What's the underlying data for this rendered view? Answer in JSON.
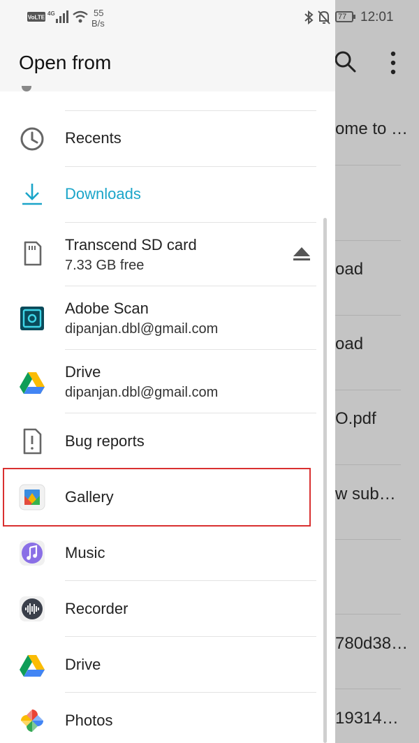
{
  "status_bar": {
    "speed_value": "55",
    "speed_unit": "B/s",
    "battery": "77",
    "time": "12:01"
  },
  "drawer": {
    "title": "Open from",
    "items": [
      {
        "label": "Recents",
        "icon": "clock-icon"
      },
      {
        "label": "Downloads",
        "icon": "download-icon",
        "selected": true
      },
      {
        "label": "Transcend SD card",
        "sub": "7.33 GB free",
        "icon": "sd-card-icon",
        "action_icon": "eject-icon"
      },
      {
        "label": "Adobe Scan",
        "sub": "dipanjan.dbl@gmail.com",
        "icon": "adobe-scan-icon"
      },
      {
        "label": "Drive",
        "sub": "dipanjan.dbl@gmail.com",
        "icon": "google-drive-icon"
      },
      {
        "label": "Bug reports",
        "icon": "bug-report-icon"
      },
      {
        "label": "Gallery",
        "icon": "gallery-icon"
      },
      {
        "label": "Music",
        "icon": "music-icon"
      },
      {
        "label": "Recorder",
        "icon": "recorder-icon"
      },
      {
        "label": "Drive",
        "icon": "google-drive-icon"
      },
      {
        "label": "Photos",
        "icon": "photos-icon"
      }
    ]
  },
  "background_list": [
    "ome to …",
    "oad",
    "oad",
    "O.pdf",
    "w sub…",
    "780d38…",
    "19314…"
  ],
  "colors": {
    "accent": "#1ba5c9",
    "highlight_border": "#d93030"
  }
}
